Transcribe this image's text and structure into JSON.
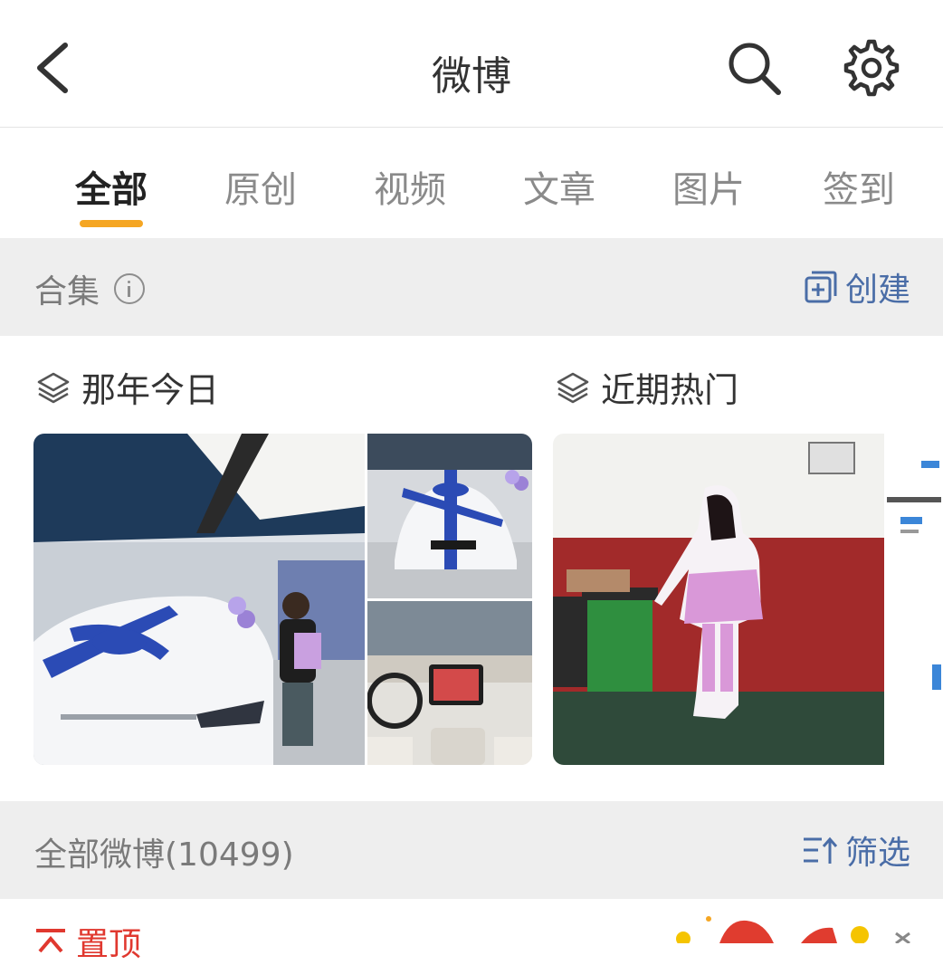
{
  "header": {
    "title": "微博"
  },
  "tabs": [
    {
      "label": "全部",
      "active": true
    },
    {
      "label": "原创",
      "active": false
    },
    {
      "label": "视频",
      "active": false
    },
    {
      "label": "文章",
      "active": false
    },
    {
      "label": "图片",
      "active": false
    },
    {
      "label": "签到",
      "active": false
    }
  ],
  "collection_bar": {
    "label": "合集",
    "create_label": "创建"
  },
  "collections": [
    {
      "title": "那年今日"
    },
    {
      "title": "近期热门"
    }
  ],
  "all_posts_bar": {
    "label": "全部微博(10499)",
    "filter_label": "筛选"
  },
  "pinned": {
    "label": "置顶"
  },
  "colors": {
    "accent": "#f5a623",
    "link": "#4a6da7",
    "pinned": "#e0382f"
  }
}
